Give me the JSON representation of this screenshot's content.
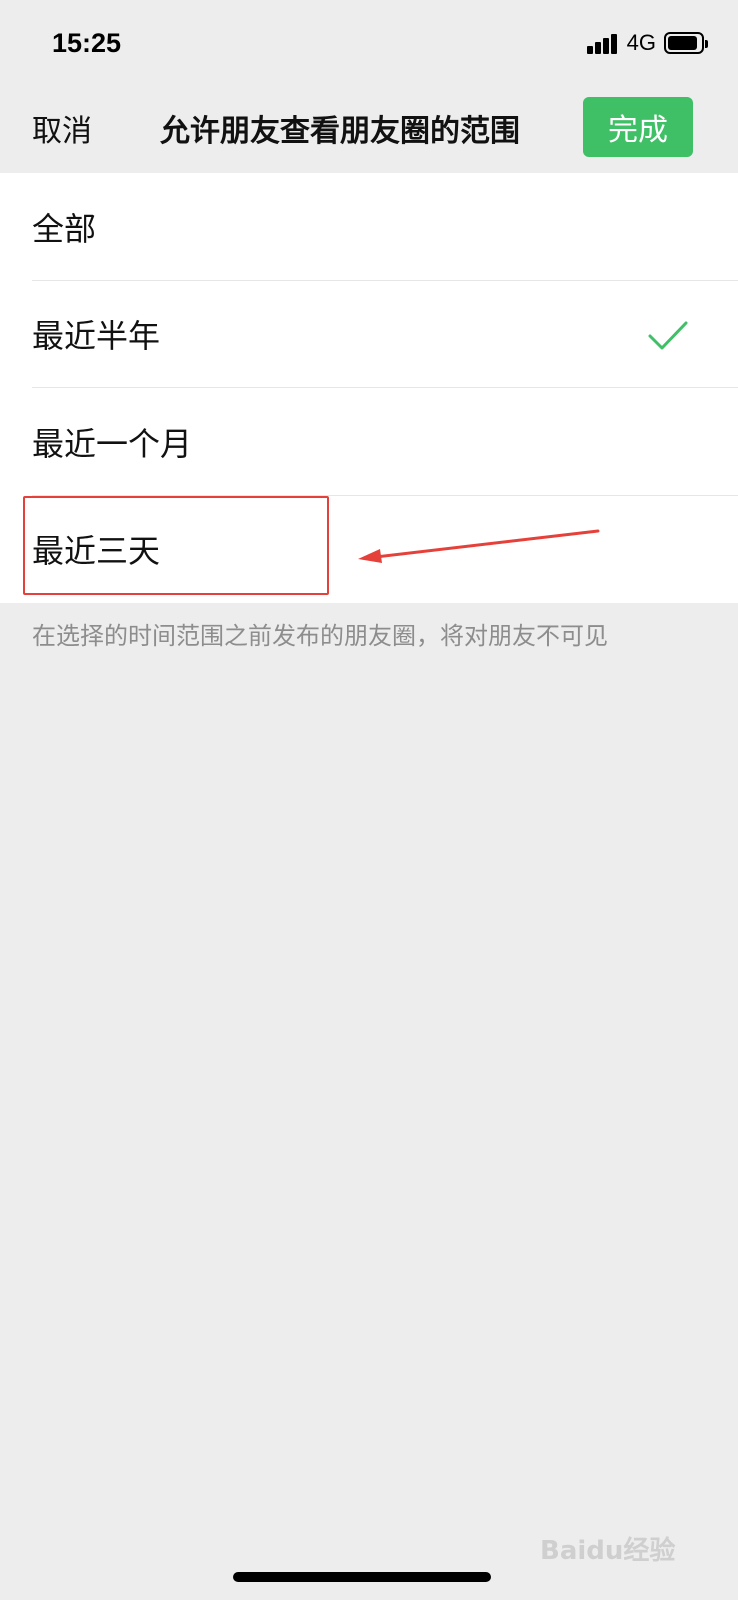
{
  "status_bar": {
    "time": "15:25",
    "network": "4G"
  },
  "nav": {
    "cancel_label": "取消",
    "title": "允许朋友查看朋友圈的范围",
    "done_label": "完成"
  },
  "options": [
    {
      "label": "全部",
      "selected": false
    },
    {
      "label": "最近半年",
      "selected": true
    },
    {
      "label": "最近一个月",
      "selected": false
    },
    {
      "label": "最近三天",
      "selected": false
    }
  ],
  "hint": "在选择的时间范围之前发布的朋友圈，将对朋友不可见",
  "watermark": "Baidu经验",
  "colors": {
    "accent": "#3fbf66",
    "annotation": "#e5413a"
  }
}
